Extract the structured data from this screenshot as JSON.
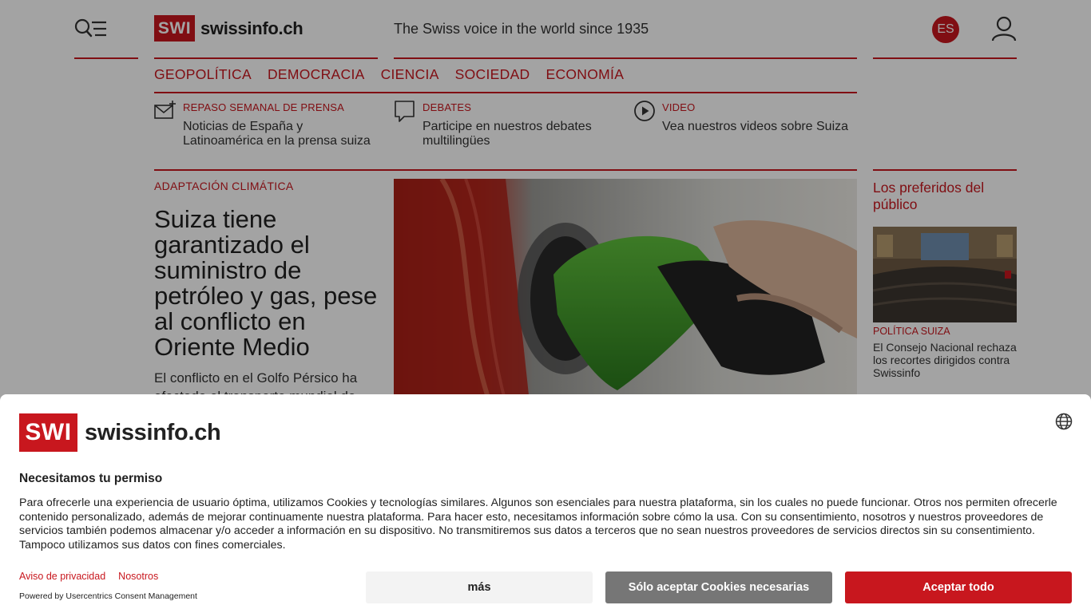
{
  "header": {
    "logo_mark": "SWI",
    "logo_text": "swissinfo.ch",
    "tagline": "The Swiss voice in the world since 1935",
    "language": "ES"
  },
  "nav": {
    "items": [
      "GEOPOLÍTICA",
      "DEMOCRACIA",
      "CIENCIA",
      "SOCIEDAD",
      "ECONOMÍA"
    ]
  },
  "quick_links": [
    {
      "kicker": "REPASO SEMANAL DE PRENSA",
      "title": "Noticias de España y Latinoamérica en la prensa suiza",
      "icon": "mail-plus-icon"
    },
    {
      "kicker": "DEBATES",
      "title": "Participe en nuestros debates multilingües",
      "icon": "chat-bubble-icon"
    },
    {
      "kicker": "VIDEO",
      "title": "Vea nuestros videos sobre Suiza",
      "icon": "play-icon"
    }
  ],
  "main_article": {
    "kicker": "ADAPTACIÓN CLIMÁTICA",
    "headline": "Suiza tiene garantizado el suministro de petróleo y gas, pese al conflicto en Oriente Medio",
    "lead": "El conflicto en el Golfo Pérsico ha afectado el transporte mundial de"
  },
  "sidebar": {
    "title": "Los preferidos del público",
    "item": {
      "kicker": "POLÍTICA SUIZA",
      "headline": "El Consejo Nacional rechaza los recortes dirigidos contra Swissinfo"
    }
  },
  "consent": {
    "logo_mark": "SWI",
    "logo_text": "swissinfo.ch",
    "title": "Necesitamos tu permiso",
    "body": "Para ofrecerle una experiencia de usuario óptima, utilizamos Cookies y tecnologías similares. Algunos son esenciales para nuestra plataforma, sin los cuales no puede funcionar. Otros nos permiten ofrecerle contenido personalizado, además de mejorar continuamente nuestra plataforma. Para hacer esto, necesitamos información sobre cómo la usa. Con su consentimiento, nosotros y nuestros proveedores de servicios también podemos almacenar y/o acceder a información en su dispositivo. No transmitiremos sus datos a terceros que no sean nuestros proveedores de servicios directos sin su consentimiento. Tampoco utilizamos sus datos con fines comerciales.",
    "privacy_link": "Aviso de privacidad",
    "about_link": "Nosotros",
    "powered_by": "Powered by Usercentrics Consent Management",
    "btn_more": "más",
    "btn_necessary": "Sólo aceptar Cookies necesarias",
    "btn_accept": "Aceptar todo"
  },
  "colors": {
    "brand_red": "#c8171e",
    "grey_button": "#767676",
    "light_button": "#f3f3f3"
  }
}
